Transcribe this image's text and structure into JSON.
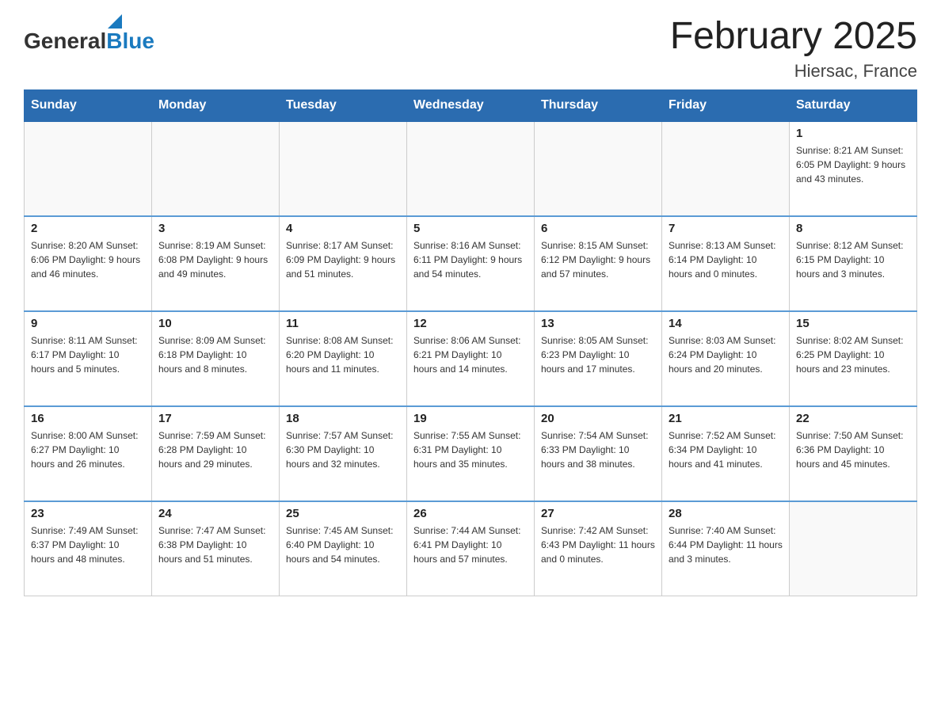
{
  "logo": {
    "general": "General",
    "blue": "Blue"
  },
  "title": "February 2025",
  "location": "Hiersac, France",
  "days_of_week": [
    "Sunday",
    "Monday",
    "Tuesday",
    "Wednesday",
    "Thursday",
    "Friday",
    "Saturday"
  ],
  "weeks": [
    [
      {
        "day": "",
        "info": ""
      },
      {
        "day": "",
        "info": ""
      },
      {
        "day": "",
        "info": ""
      },
      {
        "day": "",
        "info": ""
      },
      {
        "day": "",
        "info": ""
      },
      {
        "day": "",
        "info": ""
      },
      {
        "day": "1",
        "info": "Sunrise: 8:21 AM\nSunset: 6:05 PM\nDaylight: 9 hours and 43 minutes."
      }
    ],
    [
      {
        "day": "2",
        "info": "Sunrise: 8:20 AM\nSunset: 6:06 PM\nDaylight: 9 hours and 46 minutes."
      },
      {
        "day": "3",
        "info": "Sunrise: 8:19 AM\nSunset: 6:08 PM\nDaylight: 9 hours and 49 minutes."
      },
      {
        "day": "4",
        "info": "Sunrise: 8:17 AM\nSunset: 6:09 PM\nDaylight: 9 hours and 51 minutes."
      },
      {
        "day": "5",
        "info": "Sunrise: 8:16 AM\nSunset: 6:11 PM\nDaylight: 9 hours and 54 minutes."
      },
      {
        "day": "6",
        "info": "Sunrise: 8:15 AM\nSunset: 6:12 PM\nDaylight: 9 hours and 57 minutes."
      },
      {
        "day": "7",
        "info": "Sunrise: 8:13 AM\nSunset: 6:14 PM\nDaylight: 10 hours and 0 minutes."
      },
      {
        "day": "8",
        "info": "Sunrise: 8:12 AM\nSunset: 6:15 PM\nDaylight: 10 hours and 3 minutes."
      }
    ],
    [
      {
        "day": "9",
        "info": "Sunrise: 8:11 AM\nSunset: 6:17 PM\nDaylight: 10 hours and 5 minutes."
      },
      {
        "day": "10",
        "info": "Sunrise: 8:09 AM\nSunset: 6:18 PM\nDaylight: 10 hours and 8 minutes."
      },
      {
        "day": "11",
        "info": "Sunrise: 8:08 AM\nSunset: 6:20 PM\nDaylight: 10 hours and 11 minutes."
      },
      {
        "day": "12",
        "info": "Sunrise: 8:06 AM\nSunset: 6:21 PM\nDaylight: 10 hours and 14 minutes."
      },
      {
        "day": "13",
        "info": "Sunrise: 8:05 AM\nSunset: 6:23 PM\nDaylight: 10 hours and 17 minutes."
      },
      {
        "day": "14",
        "info": "Sunrise: 8:03 AM\nSunset: 6:24 PM\nDaylight: 10 hours and 20 minutes."
      },
      {
        "day": "15",
        "info": "Sunrise: 8:02 AM\nSunset: 6:25 PM\nDaylight: 10 hours and 23 minutes."
      }
    ],
    [
      {
        "day": "16",
        "info": "Sunrise: 8:00 AM\nSunset: 6:27 PM\nDaylight: 10 hours and 26 minutes."
      },
      {
        "day": "17",
        "info": "Sunrise: 7:59 AM\nSunset: 6:28 PM\nDaylight: 10 hours and 29 minutes."
      },
      {
        "day": "18",
        "info": "Sunrise: 7:57 AM\nSunset: 6:30 PM\nDaylight: 10 hours and 32 minutes."
      },
      {
        "day": "19",
        "info": "Sunrise: 7:55 AM\nSunset: 6:31 PM\nDaylight: 10 hours and 35 minutes."
      },
      {
        "day": "20",
        "info": "Sunrise: 7:54 AM\nSunset: 6:33 PM\nDaylight: 10 hours and 38 minutes."
      },
      {
        "day": "21",
        "info": "Sunrise: 7:52 AM\nSunset: 6:34 PM\nDaylight: 10 hours and 41 minutes."
      },
      {
        "day": "22",
        "info": "Sunrise: 7:50 AM\nSunset: 6:36 PM\nDaylight: 10 hours and 45 minutes."
      }
    ],
    [
      {
        "day": "23",
        "info": "Sunrise: 7:49 AM\nSunset: 6:37 PM\nDaylight: 10 hours and 48 minutes."
      },
      {
        "day": "24",
        "info": "Sunrise: 7:47 AM\nSunset: 6:38 PM\nDaylight: 10 hours and 51 minutes."
      },
      {
        "day": "25",
        "info": "Sunrise: 7:45 AM\nSunset: 6:40 PM\nDaylight: 10 hours and 54 minutes."
      },
      {
        "day": "26",
        "info": "Sunrise: 7:44 AM\nSunset: 6:41 PM\nDaylight: 10 hours and 57 minutes."
      },
      {
        "day": "27",
        "info": "Sunrise: 7:42 AM\nSunset: 6:43 PM\nDaylight: 11 hours and 0 minutes."
      },
      {
        "day": "28",
        "info": "Sunrise: 7:40 AM\nSunset: 6:44 PM\nDaylight: 11 hours and 3 minutes."
      },
      {
        "day": "",
        "info": ""
      }
    ]
  ]
}
